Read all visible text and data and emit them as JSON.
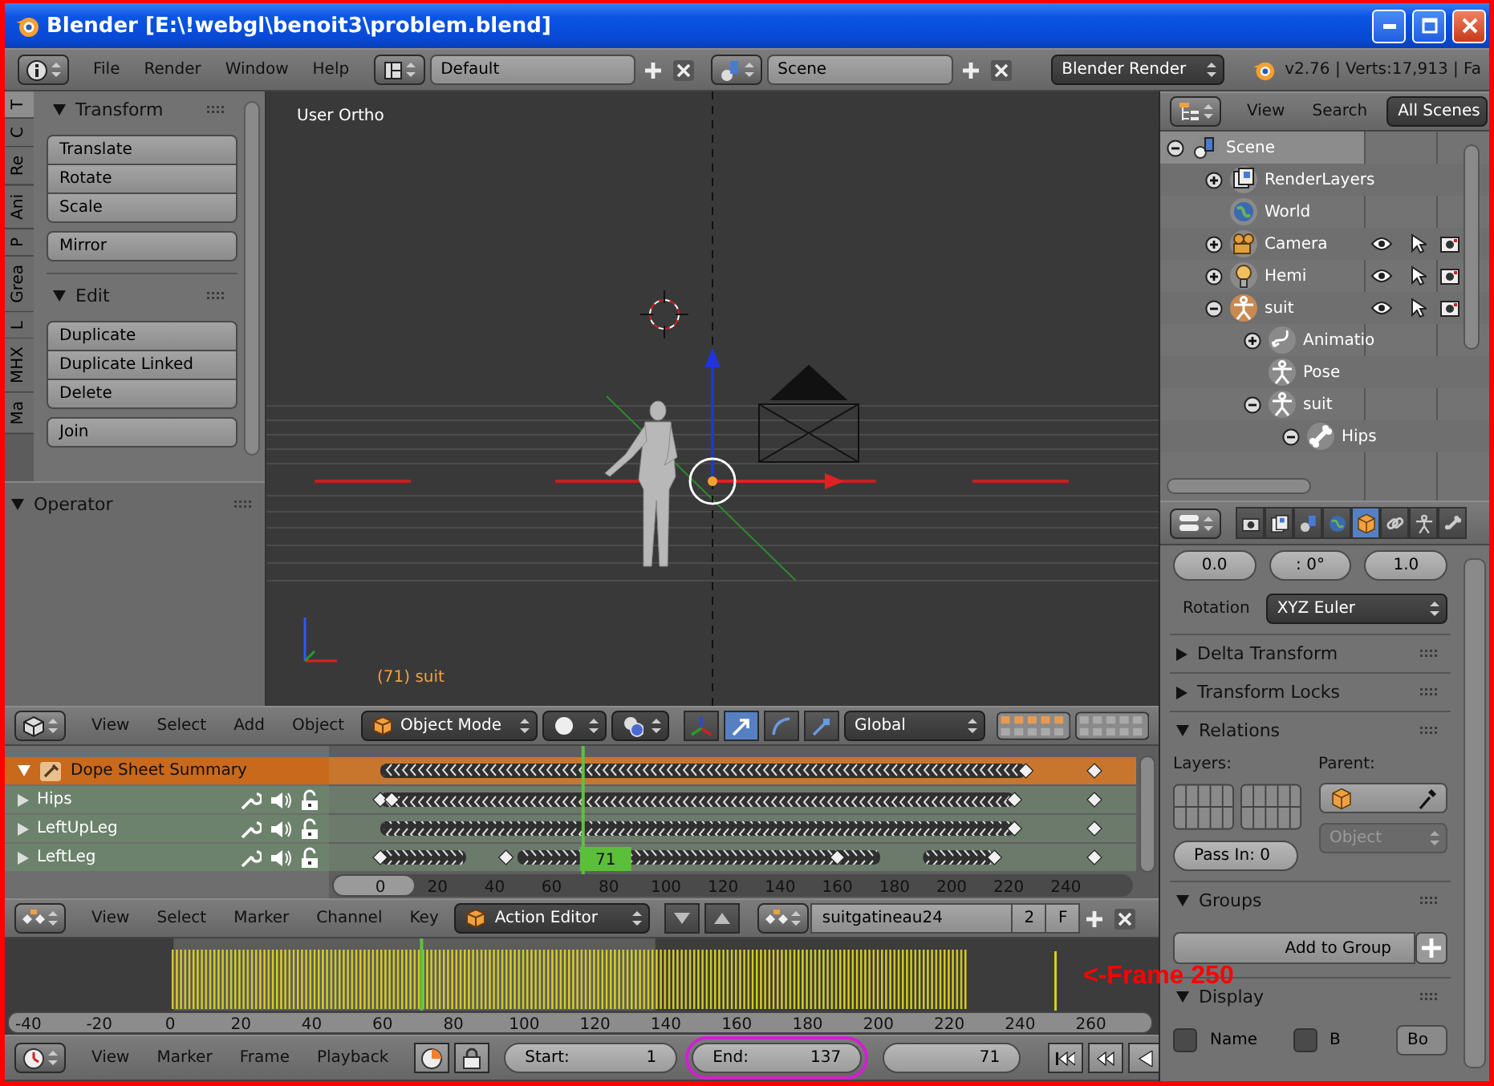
{
  "window": {
    "title": "Blender [E:\\!webgl\\benoit3\\problem.blend]"
  },
  "info_header": {
    "menus": [
      "File",
      "Render",
      "Window",
      "Help"
    ],
    "screen": "Default",
    "scene": "Scene",
    "render_engine": "Blender Render",
    "stats": "v2.76 | Verts:17,913 | Fa"
  },
  "tool_shelf": {
    "tabs": [
      {
        "label": "T",
        "selected": true
      },
      {
        "label": "C",
        "selected": false
      },
      {
        "label": "Re",
        "selected": false
      },
      {
        "label": "Ani",
        "selected": false
      },
      {
        "label": "P",
        "selected": false
      },
      {
        "label": "Grea",
        "selected": false
      },
      {
        "label": "L",
        "selected": false
      },
      {
        "label": "MHX",
        "selected": false
      },
      {
        "label": "Ma",
        "selected": false
      }
    ],
    "panels": [
      {
        "title": "Transform",
        "expanded": true,
        "groups": [
          [
            "Translate",
            "Rotate",
            "Scale"
          ],
          [
            "Mirror"
          ]
        ]
      },
      {
        "title": "Edit",
        "expanded": true,
        "groups": [
          [
            "Duplicate",
            "Duplicate Linked",
            "Delete"
          ],
          [
            "Join"
          ]
        ]
      }
    ],
    "operator_panel": {
      "title": "Operator",
      "expanded": true
    }
  },
  "viewport": {
    "view_name": "User Ortho",
    "active_object": "(71) suit"
  },
  "viewport_header": {
    "menus": [
      "View",
      "Select",
      "Add",
      "Object"
    ],
    "mode": "Object Mode",
    "orientation": "Global"
  },
  "dope_sheet": {
    "channels": [
      {
        "name": "Dope Sheet Summary",
        "kind": "summary",
        "expanded": true
      },
      {
        "name": "Hips",
        "kind": "group",
        "expanded": false
      },
      {
        "name": "LeftUpLeg",
        "kind": "group",
        "expanded": false
      },
      {
        "name": "LeftLeg",
        "kind": "group",
        "expanded": false
      }
    ],
    "frame_ruler": [
      "0",
      "20",
      "40",
      "60",
      "80",
      "100",
      "120",
      "140",
      "160",
      "180",
      "200",
      "220",
      "240"
    ],
    "current_frame": "71"
  },
  "dope_sheet_header": {
    "menus": [
      "View",
      "Select",
      "Marker",
      "Channel",
      "Key"
    ],
    "mode": "Action Editor",
    "action": "suitgatineau24",
    "users": "2",
    "fake_user": "F"
  },
  "timeline": {
    "frame_ruler": [
      "-40",
      "-20",
      "0",
      "20",
      "40",
      "60",
      "80",
      "100",
      "120",
      "140",
      "160",
      "180",
      "200",
      "220",
      "240",
      "260"
    ],
    "annotation": "<-Frame 250"
  },
  "timeline_header": {
    "menus": [
      "View",
      "Marker",
      "Frame",
      "Playback"
    ],
    "start_label": "Start:",
    "start": "1",
    "end_label": "End:",
    "end": "137",
    "end_highlighted": true,
    "current": "71"
  },
  "outliner": {
    "menus": [
      "View",
      "Search"
    ],
    "filter": "All Scenes",
    "tree": [
      {
        "name": "Scene",
        "kind": "scene",
        "expanded": true,
        "selected": true,
        "active": false,
        "children": [
          {
            "name": "RenderLayers",
            "kind": "renderlayers",
            "expanded": false,
            "selected": false,
            "active": false
          },
          {
            "name": "World",
            "kind": "world",
            "selected": false,
            "active": false
          },
          {
            "name": "Camera",
            "kind": "camera",
            "expanded": false,
            "selected": false,
            "active": false
          },
          {
            "name": "Hemi",
            "kind": "lamp",
            "expanded": false,
            "selected": false,
            "active": false
          },
          {
            "name": "suit",
            "kind": "armature",
            "expanded": true,
            "selected": false,
            "active": true,
            "children": [
              {
                "name": "Animatio",
                "kind": "animation",
                "expanded": false,
                "selected": false,
                "active": false
              },
              {
                "name": "Pose",
                "kind": "pose",
                "selected": false,
                "active": false
              },
              {
                "name": "suit",
                "kind": "skeleton",
                "expanded": true,
                "selected": false,
                "active": false,
                "children": [
                  {
                    "name": "Hips",
                    "kind": "bone",
                    "expanded": true,
                    "selected": false,
                    "active": false
                  }
                ]
              }
            ]
          }
        ]
      }
    ]
  },
  "properties": {
    "tabs": [
      {
        "kind": "render",
        "selected": false
      },
      {
        "kind": "render_layers",
        "selected": false
      },
      {
        "kind": "scene",
        "selected": false
      },
      {
        "kind": "world",
        "selected": false
      },
      {
        "kind": "object",
        "selected": true
      },
      {
        "kind": "constraints",
        "selected": false
      },
      {
        "kind": "object_data",
        "selected": false
      },
      {
        "kind": "bone",
        "selected": false
      }
    ],
    "scale_fields": [
      "0.0",
      ": 0°",
      "1.0"
    ],
    "rotation_label": "Rotation",
    "rotation_mode": "XYZ Euler",
    "panels": [
      {
        "title": "Delta Transform",
        "expanded": false
      },
      {
        "title": "Transform Locks",
        "expanded": false
      },
      {
        "kind": "relations",
        "title": "Relations",
        "expanded": true,
        "layers_label": "Layers:",
        "parent_label": "Parent:",
        "parent_type": "Object",
        "parent_type_disabled": true,
        "pass_index": "Pass In: 0"
      },
      {
        "kind": "groups",
        "title": "Groups",
        "expanded": true,
        "add_button": "Add to Group"
      },
      {
        "kind": "display",
        "title": "Display",
        "expanded": true,
        "options": [
          {
            "label": "Name",
            "checked": false
          },
          {
            "label": "B",
            "checked": false
          }
        ],
        "draw_type": "Bo"
      }
    ]
  }
}
